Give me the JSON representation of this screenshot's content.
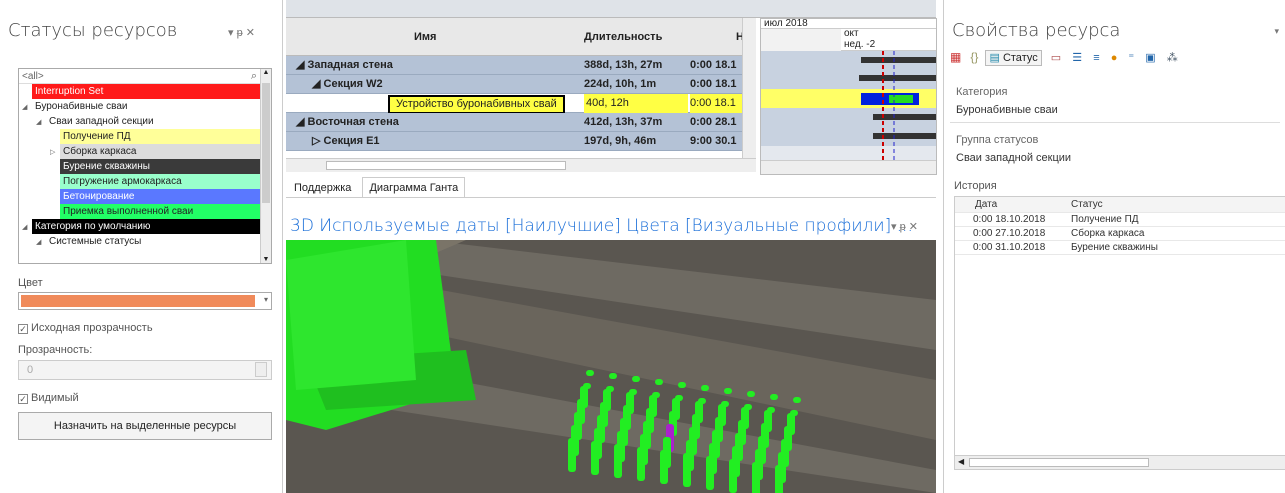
{
  "left": {
    "title": "Статусы ресурсов",
    "pin": "▾ ᵽ ✕",
    "search_value": "<all>",
    "tree": [
      {
        "label": "Interruption Set",
        "bg": "#ff1a1a",
        "fg": "#ffffff",
        "indent": 0,
        "exp": ""
      },
      {
        "label": "Буронабивные сваи",
        "bg": "#ffffff",
        "fg": "#222222",
        "indent": 0,
        "exp": "◢"
      },
      {
        "label": "Сваи западной секции",
        "bg": "#ffffff",
        "fg": "#222222",
        "indent": 1,
        "exp": "◢"
      },
      {
        "label": "Получение ПД",
        "bg": "#ffff99",
        "fg": "#222222",
        "indent": 2,
        "exp": ""
      },
      {
        "label": "Сборка каркаса",
        "bg": "#dcdcdc",
        "fg": "#222222",
        "indent": 2,
        "exp": "▷"
      },
      {
        "label": "Бурение скважины",
        "bg": "#3a3a3a",
        "fg": "#ffffff",
        "indent": 2,
        "exp": ""
      },
      {
        "label": "Погружение армокаркаса",
        "bg": "#99ffcc",
        "fg": "#222222",
        "indent": 2,
        "exp": ""
      },
      {
        "label": "Бетонирование",
        "bg": "#5a78ff",
        "fg": "#ffffff",
        "indent": 2,
        "exp": ""
      },
      {
        "label": "Приемка выполненной сваи",
        "bg": "#22ff66",
        "fg": "#222222",
        "indent": 2,
        "exp": ""
      },
      {
        "label": "Категория по умолчанию",
        "bg": "#000000",
        "fg": "#ffffff",
        "indent": 0,
        "exp": "◢"
      },
      {
        "label": "Системные статусы",
        "bg": "#ffffff",
        "fg": "#222222",
        "indent": 1,
        "exp": "◢"
      }
    ],
    "color_label": "Цвет",
    "color_value": "#f08a5a",
    "orig_transparency": "Исходная прозрачность",
    "transparency_label": "Прозрачность:",
    "transparency_value": "0",
    "visible_label": "Видимый",
    "assign_button": "Назначить на выделенные ресурсы"
  },
  "gantt": {
    "col_name": "Имя",
    "col_dur": "Длительность",
    "col_start": "Н",
    "rows": [
      {
        "name": "◢ Западная стена",
        "dur": "388d, 13h, 27m",
        "start": "0:00 18.1",
        "indent": 0,
        "sel": false
      },
      {
        "name": "◢ Секция W2",
        "dur": "224d, 10h, 1m",
        "start": "0:00 18.1",
        "indent": 1,
        "sel": false
      },
      {
        "name": "Устройство буронабивных свай",
        "dur": "40d, 12h",
        "start": "0:00 18.1",
        "indent": 2,
        "sel": true
      },
      {
        "name": "◢ Восточная стена",
        "dur": "412d, 13h, 37m",
        "start": "0:00 28.1",
        "indent": 0,
        "sel": false
      },
      {
        "name": "▷ Секция E1",
        "dur": "197d, 9h, 46m",
        "start": "9:00 30.1",
        "indent": 1,
        "sel": false
      }
    ],
    "tab1": "Поддержка",
    "tab2": "Диаграмма Ганта",
    "chart_month": "июл 2018",
    "chart_oct": "окт",
    "chart_week": "нед. -2"
  },
  "view3d": {
    "title": "3D Используемые даты [Наилучшие] Цвета [Визуальные профили]  ...",
    "pin": "▾ ᵽ ✕"
  },
  "right": {
    "title": "Свойства ресурса",
    "tab_status": "Статус",
    "cat_label": "Категория",
    "cat_value": "Буронабивные сваи",
    "group_label": "Группа статусов",
    "group_value": "Сваи западной секции",
    "history_label": "История",
    "h_date": "Дата",
    "h_status": "Статус",
    "history": [
      {
        "date": "0:00 18.10.2018",
        "status": "Получение ПД"
      },
      {
        "date": "0:00 27.10.2018",
        "status": "Сборка каркаса"
      },
      {
        "date": "0:00 31.10.2018",
        "status": "Бурение скважины"
      }
    ]
  }
}
